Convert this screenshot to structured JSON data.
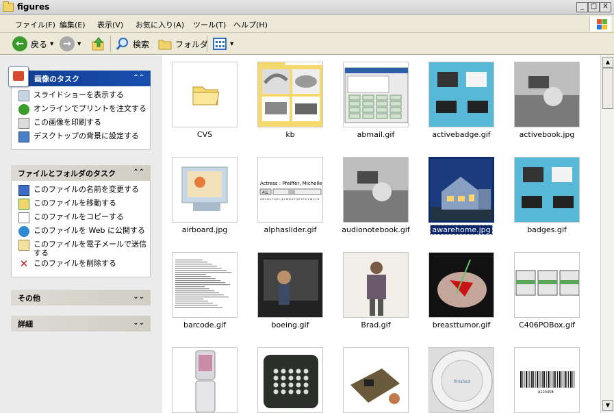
{
  "window": {
    "title": "figures",
    "minimize": "_",
    "maximize": "□",
    "close": "X"
  },
  "menubar": {
    "items": [
      "ファイル(F)",
      "編集(E)",
      "表示(V)",
      "お気に入り(A)",
      "ツール(T)",
      "ヘルプ(H)"
    ]
  },
  "toolbar": {
    "back": "戻る",
    "search": "検索",
    "folders": "フォルダ"
  },
  "image_tasks": {
    "title": "画像のタスク",
    "items": [
      "スライドショーを表示する",
      "オンラインでプリントを注文する",
      "この画像を印刷する",
      "デスクトップの背景に設定する"
    ]
  },
  "file_tasks": {
    "title": "ファイルとフォルダのタスク",
    "items": [
      "このファイルの名前を変更する",
      "このファイルを移動する",
      "このファイルをコピーする",
      "このファイルを Web に公開する",
      "このファイルを電子メールで送信する",
      "このファイルを削除する"
    ]
  },
  "other_places": {
    "title": "その他"
  },
  "details": {
    "title": "詳細"
  },
  "files": [
    {
      "name": "CVS",
      "kind": "folder"
    },
    {
      "name": "kb",
      "kind": "folder-thumbs"
    },
    {
      "name": "abmail.gif",
      "kind": "app"
    },
    {
      "name": "activebadge.gif",
      "kind": "badge"
    },
    {
      "name": "activebook.jpg",
      "kind": "photo-gray"
    },
    {
      "name": "airboard.jpg",
      "kind": "monitor"
    },
    {
      "name": "alphaslider.gif",
      "kind": "slider",
      "text": "Actress : Pfeiffer, Michelle",
      "btn": "ALL",
      "letters": "A B C D E F G H I J K L M N O P Q R S T U V W X Y Z"
    },
    {
      "name": "audionotebook.gif",
      "kind": "photo-gray"
    },
    {
      "name": "awarehome.jpg",
      "kind": "house",
      "selected": true
    },
    {
      "name": "badges.gif",
      "kind": "badge"
    },
    {
      "name": "barcode.gif",
      "kind": "table"
    },
    {
      "name": "boeing.gif",
      "kind": "photo-dark"
    },
    {
      "name": "Brad.gif",
      "kind": "person"
    },
    {
      "name": "breasttumor.gif",
      "kind": "medical"
    },
    {
      "name": "C406POBox.gif",
      "kind": "screens"
    },
    {
      "name": "",
      "kind": "phone"
    },
    {
      "name": "",
      "kind": "keypad"
    },
    {
      "name": "",
      "kind": "circuit"
    },
    {
      "name": "",
      "kind": "dial",
      "text": "finished"
    },
    {
      "name": "",
      "kind": "barcode",
      "text": "A12345B"
    }
  ]
}
